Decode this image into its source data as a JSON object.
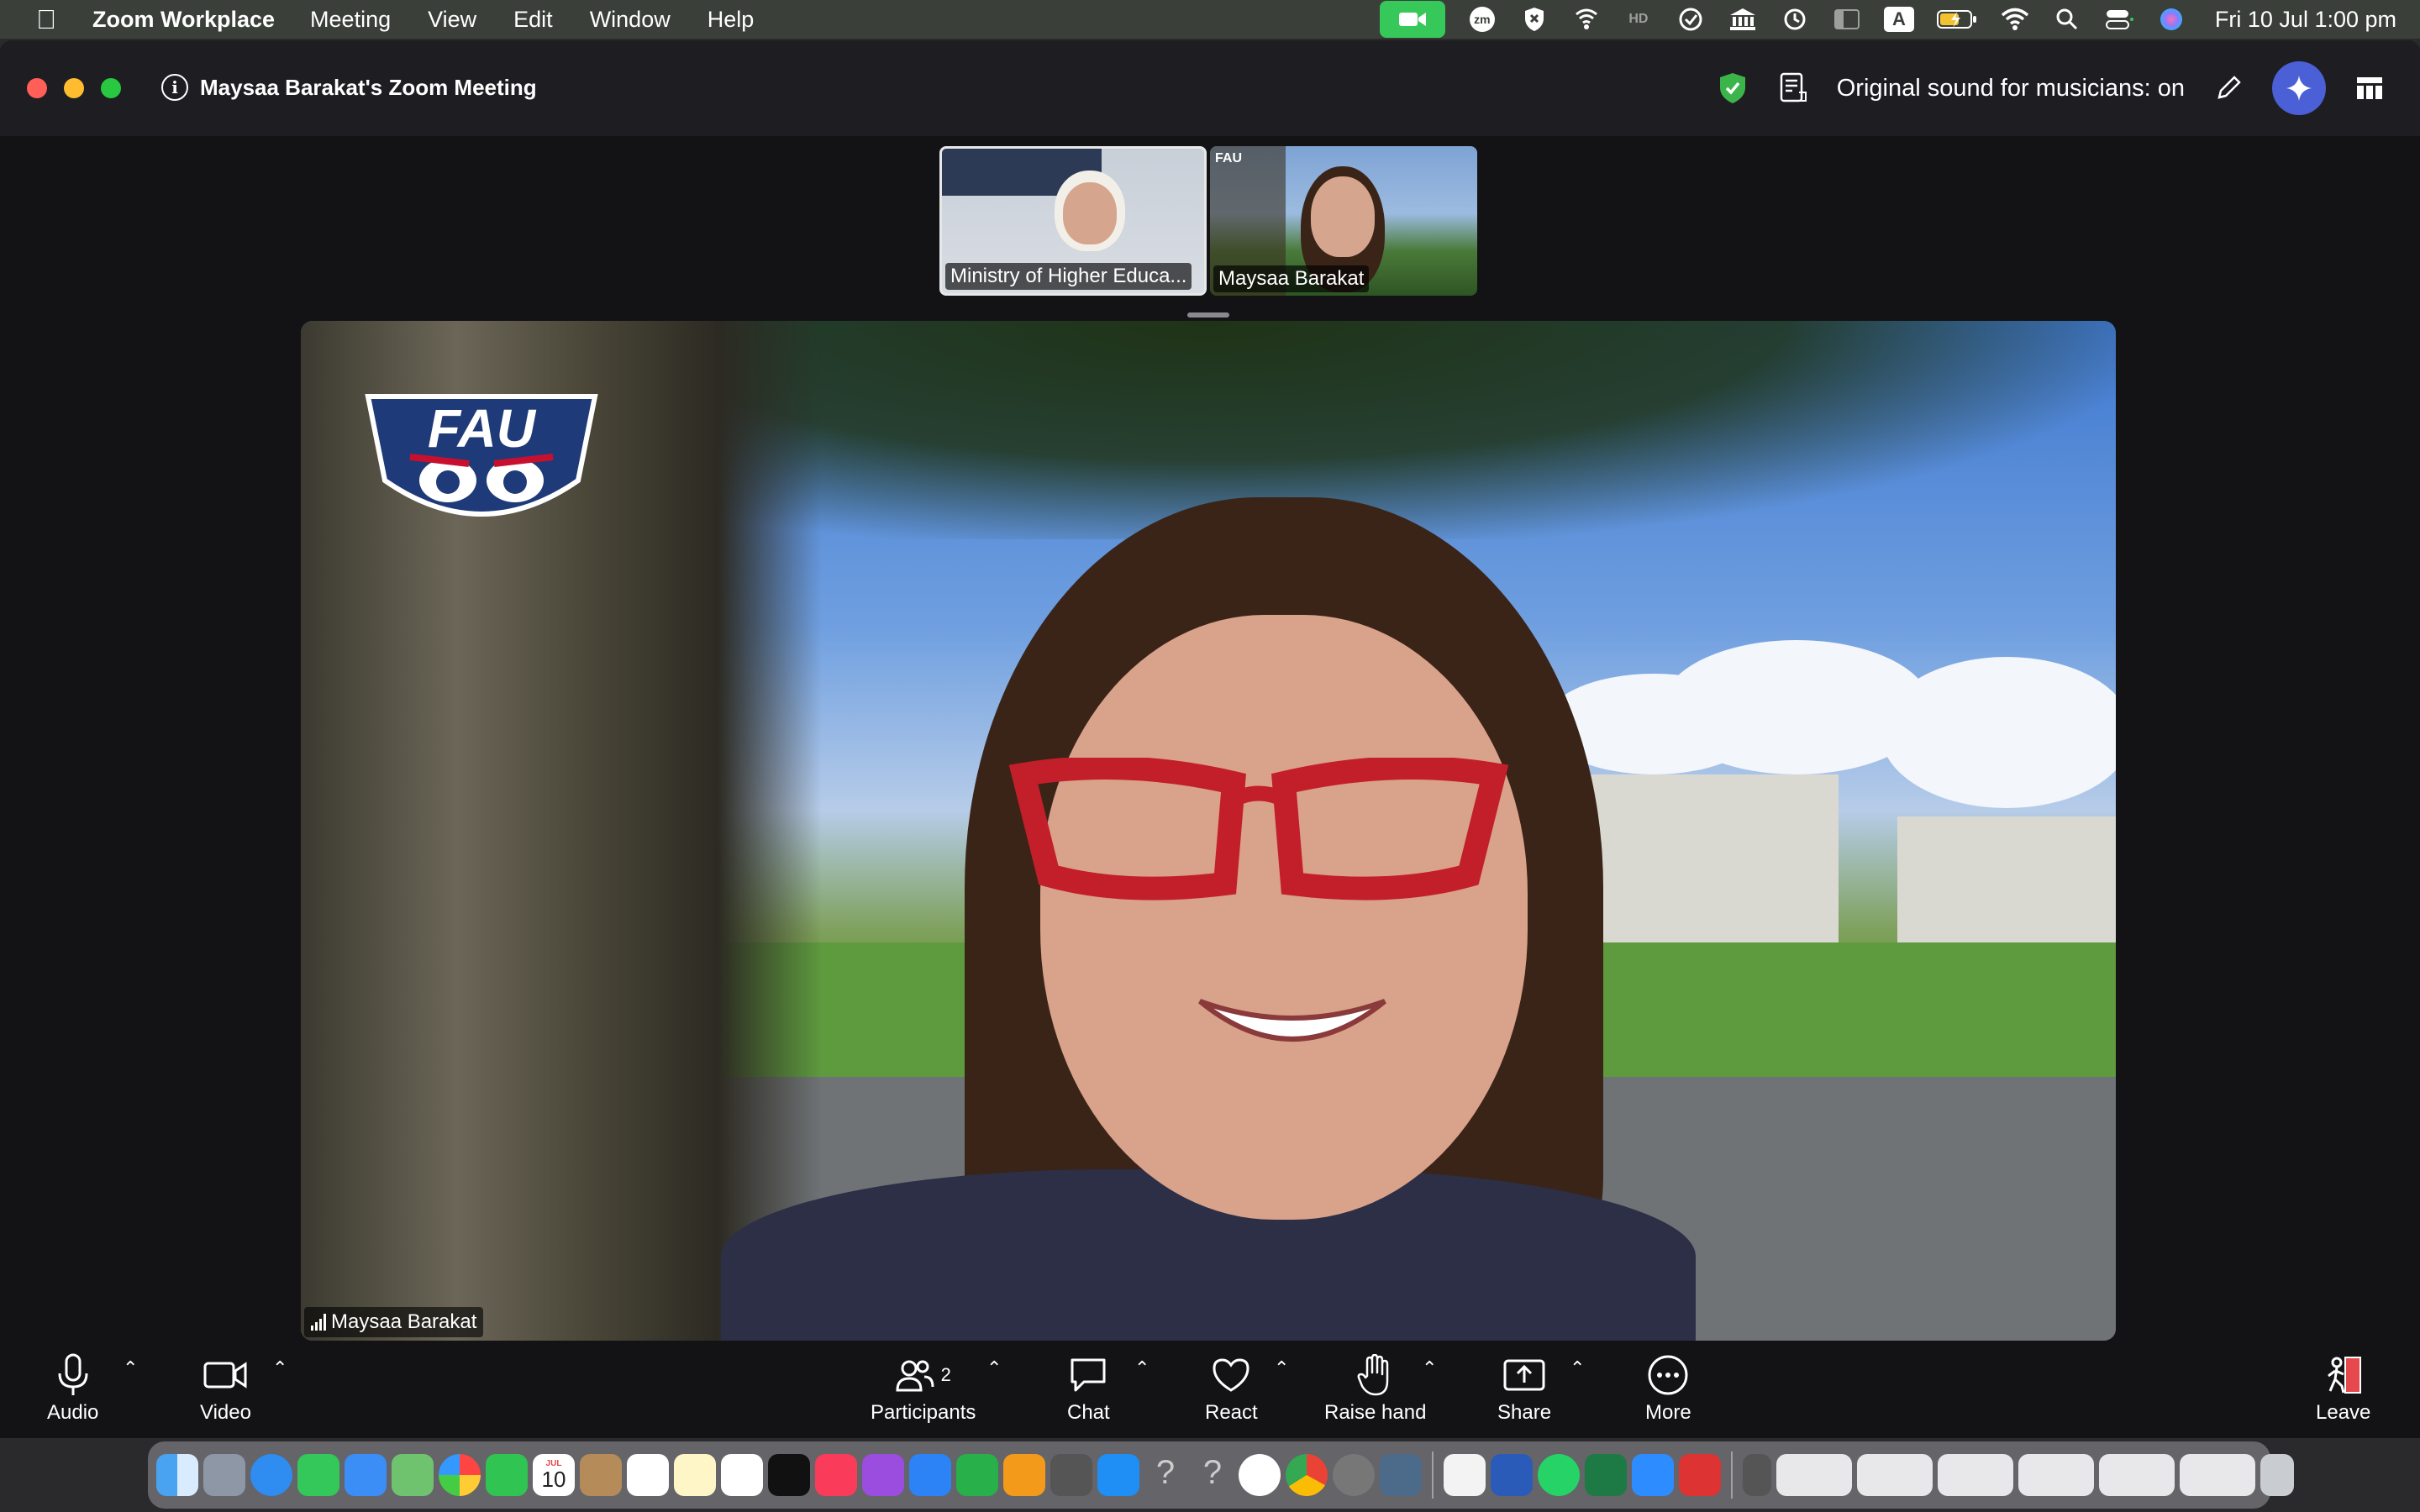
{
  "menubar": {
    "app_name": "Zoom Workplace",
    "items": [
      "Meeting",
      "View",
      "Edit",
      "Window",
      "Help"
    ],
    "clock": "Fri 10 Jul  1:00 pm",
    "status_icons": [
      "zoom-camera-icon",
      "zm-icon",
      "shield-x-icon",
      "wifi-off-icon",
      "hd-icon",
      "check-circle-icon",
      "bank-icon",
      "time-machine-icon",
      "sidebar-icon",
      "keyboard-a-icon",
      "battery-charging-icon",
      "wifi-icon",
      "search-icon",
      "control-center-icon",
      "siri-icon"
    ],
    "keyboard_label": "A",
    "zm_label": "zm"
  },
  "window": {
    "meeting_title": "Maysaa Barakat's Zoom Meeting",
    "sound_status": "Original sound for musicians: on"
  },
  "thumbnails": [
    {
      "name": "Ministry of Higher Educa..."
    },
    {
      "name": "Maysaa Barakat"
    }
  ],
  "main_video": {
    "participant_name": "Maysaa Barakat",
    "logo_text": "FAU"
  },
  "toolbar": {
    "audio": "Audio",
    "video": "Video",
    "participants": "Participants",
    "participants_count": "2",
    "chat": "Chat",
    "react": "React",
    "raise_hand": "Raise hand",
    "share": "Share",
    "more": "More",
    "leave": "Leave"
  },
  "dock": {
    "calendar_day": "10",
    "calendar_month": "JUL"
  },
  "colors": {
    "accent_green": "#37c85a",
    "leave_red": "#e5484d",
    "ai_blue": "#4b5fd6"
  }
}
